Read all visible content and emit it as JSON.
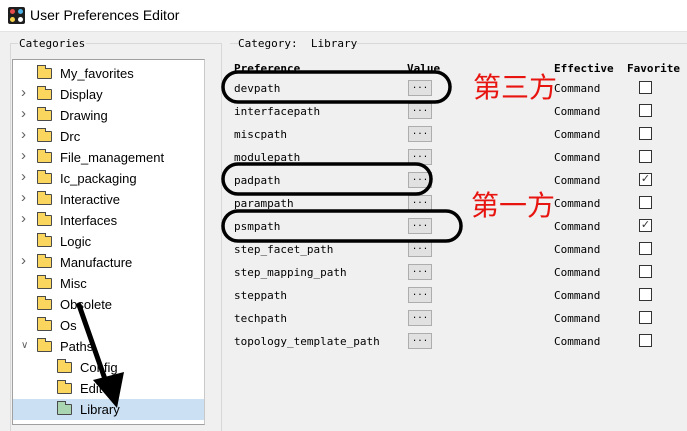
{
  "window": {
    "title": "User Preferences Editor"
  },
  "categories_panel": {
    "label": "Categories",
    "items": [
      {
        "label": "My_favorites",
        "expandable": false,
        "selected": false
      },
      {
        "label": "Display",
        "expandable": true,
        "selected": false
      },
      {
        "label": "Drawing",
        "expandable": true,
        "selected": false
      },
      {
        "label": "Drc",
        "expandable": true,
        "selected": false
      },
      {
        "label": "File_management",
        "expandable": true,
        "selected": false
      },
      {
        "label": "Ic_packaging",
        "expandable": true,
        "selected": false
      },
      {
        "label": "Interactive",
        "expandable": true,
        "selected": false
      },
      {
        "label": "Interfaces",
        "expandable": true,
        "selected": false
      },
      {
        "label": "Logic",
        "expandable": false,
        "selected": false
      },
      {
        "label": "Manufacture",
        "expandable": true,
        "selected": false
      },
      {
        "label": "Misc",
        "expandable": false,
        "selected": false
      },
      {
        "label": "Obsolete",
        "expandable": false,
        "selected": false
      },
      {
        "label": "Os",
        "expandable": false,
        "selected": false
      },
      {
        "label": "Paths",
        "expandable": true,
        "expanded": true,
        "selected": false
      },
      {
        "label": "Config",
        "child": true,
        "selected": false
      },
      {
        "label": "Editor",
        "child": true,
        "selected": false
      },
      {
        "label": "Library",
        "child": true,
        "selected": true
      }
    ]
  },
  "main": {
    "category_label": "Category:",
    "category_value": "Library",
    "columns": {
      "preference": "Preference",
      "value": "Value",
      "effective": "Effective",
      "favorite": "Favorite"
    },
    "rows": [
      {
        "name": "devpath",
        "value_button": "...",
        "effective": "Command",
        "favorite": false
      },
      {
        "name": "interfacepath",
        "value_button": "...",
        "effective": "Command",
        "favorite": false
      },
      {
        "name": "miscpath",
        "value_button": "...",
        "effective": "Command",
        "favorite": false
      },
      {
        "name": "modulepath",
        "value_button": "...",
        "effective": "Command",
        "favorite": false
      },
      {
        "name": "padpath",
        "value_button": "...",
        "effective": "Command",
        "favorite": true
      },
      {
        "name": "parampath",
        "value_button": "...",
        "effective": "Command",
        "favorite": false
      },
      {
        "name": "psmpath",
        "value_button": "...",
        "effective": "Command",
        "favorite": true
      },
      {
        "name": "step_facet_path",
        "value_button": "...",
        "effective": "Command",
        "favorite": false
      },
      {
        "name": "step_mapping_path",
        "value_button": "...",
        "effective": "Command",
        "favorite": false
      },
      {
        "name": "steppath",
        "value_button": "...",
        "effective": "Command",
        "favorite": false
      },
      {
        "name": "techpath",
        "value_button": "...",
        "effective": "Command",
        "favorite": false
      },
      {
        "name": "topology_template_path",
        "value_button": "...",
        "effective": "Command",
        "favorite": false
      }
    ]
  },
  "annotations": {
    "third_party": "第三方",
    "first_party": "第一方",
    "color": "#e8140f"
  }
}
